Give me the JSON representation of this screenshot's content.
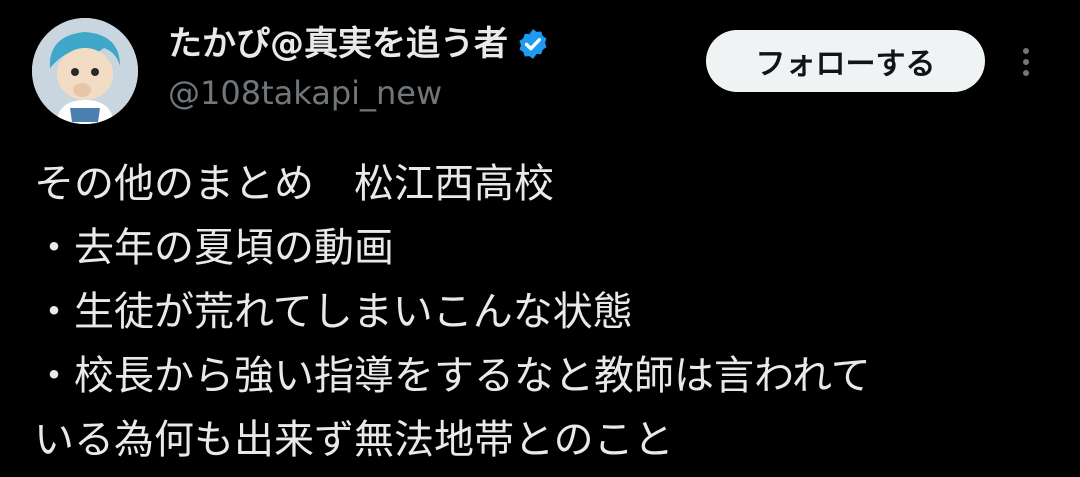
{
  "author": {
    "display_name": "たかぴ@真実を追う者",
    "handle": "@108takapi_new",
    "avatar_icon": "avatar-icon",
    "verified_icon": "verified-badge-icon",
    "verified_color": "#1d9bf0"
  },
  "actions": {
    "follow_label": "フォローする",
    "more_icon": "more-options-icon"
  },
  "tweet": {
    "lines": [
      "その他のまとめ　松江西高校",
      "・去年の夏頃の動画",
      "・生徒が荒れてしまいこんな状態",
      "・校長から強い指導をするなと教師は言われて",
      "いる為何も出来ず無法地帯とのこと"
    ]
  },
  "colors": {
    "background": "#000000",
    "primary_text": "#e7e9ea",
    "secondary_text": "#71767b",
    "button_bg": "#eff3f4",
    "button_text": "#0f1419"
  }
}
